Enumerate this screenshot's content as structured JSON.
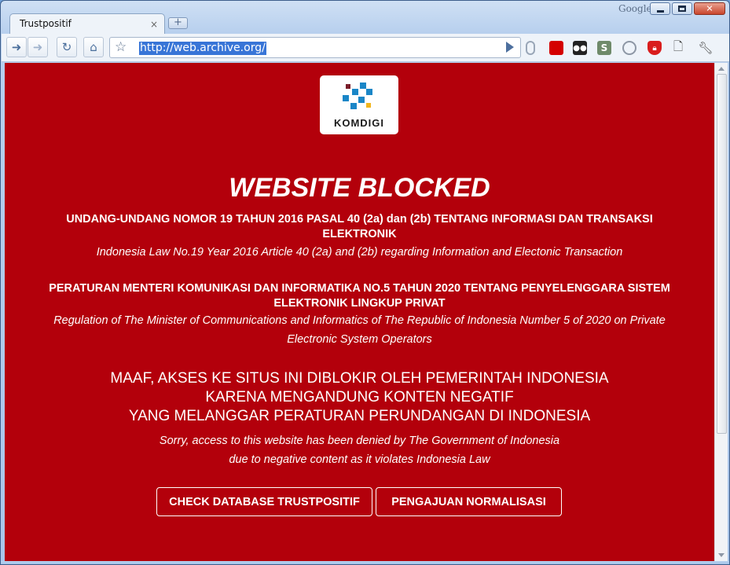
{
  "window": {
    "brand": "Google"
  },
  "tabs": [
    {
      "title": "Trustpositif",
      "close": "×"
    }
  ],
  "new_tab": "+",
  "toolbar": {
    "url": "http://web.archive.org/"
  },
  "page": {
    "logo_text": "KOMDIGI",
    "title": "WEBSITE BLOCKED",
    "law1_bold": "UNDANG-UNDANG NOMOR 19 TAHUN 2016 PASAL 40 (2a) dan (2b) TENTANG INFORMASI DAN TRANSAKSI ELEKTRONIK",
    "law1_italic": "Indonesia Law No.19 Year 2016 Article 40 (2a) and (2b) regarding Information and Electonic Transaction",
    "law2_bold": "PERATURAN MENTERI KOMUNIKASI DAN INFORMATIKA NO.5 TAHUN 2020 TENTANG PENYELENGGARA SISTEM ELEKTRONIK LINGKUP PRIVAT",
    "law2_italic": "Regulation of The Minister of Communications and Informatics of The Republic of Indonesia Number 5 of 2020 on Private Electronic System Operators",
    "warning_lines": [
      "MAAF, AKSES KE SITUS INI DIBLOKIR OLEH PEMERINTAH INDONESIA",
      "KARENA MENGANDUNG KONTEN NEGATIF",
      "YANG MELANGGAR PERATURAN PERUNDANGAN DI INDONESIA"
    ],
    "sorry_lines": [
      "Sorry, access to this website has been denied by The Government of Indonesia",
      "due to negative content as it violates Indonesia Law"
    ],
    "buttons": {
      "check": "CHECK DATABASE TRUSTPOSITIF",
      "normalize": "PENGAJUAN NORMALISASI"
    }
  },
  "colors": {
    "page_bg": "#b3000b",
    "text": "#ffffff"
  }
}
